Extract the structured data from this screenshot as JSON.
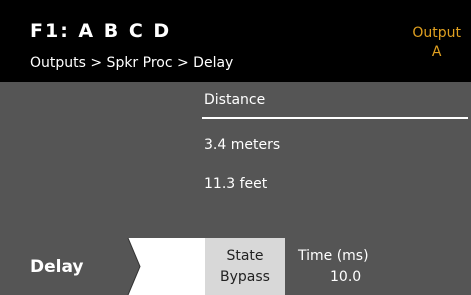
{
  "header": {
    "title": "F1: A B C D",
    "breadcrumb": "Outputs > Spkr Proc > Delay",
    "output_label": "Output",
    "output_value": "A"
  },
  "main": {
    "field_label": "Distance",
    "distance_meters": "3.4 meters",
    "distance_feet": "11.3 feet"
  },
  "footer": {
    "tab_label": "Delay",
    "state_label": "State",
    "state_value": "Bypass",
    "time_label": "Time (ms)",
    "time_value": "10.0"
  },
  "colors": {
    "header_bg": "#000000",
    "content_bg": "#555555",
    "accent": "#e0a020",
    "state_button_bg": "#d8d8d8"
  }
}
